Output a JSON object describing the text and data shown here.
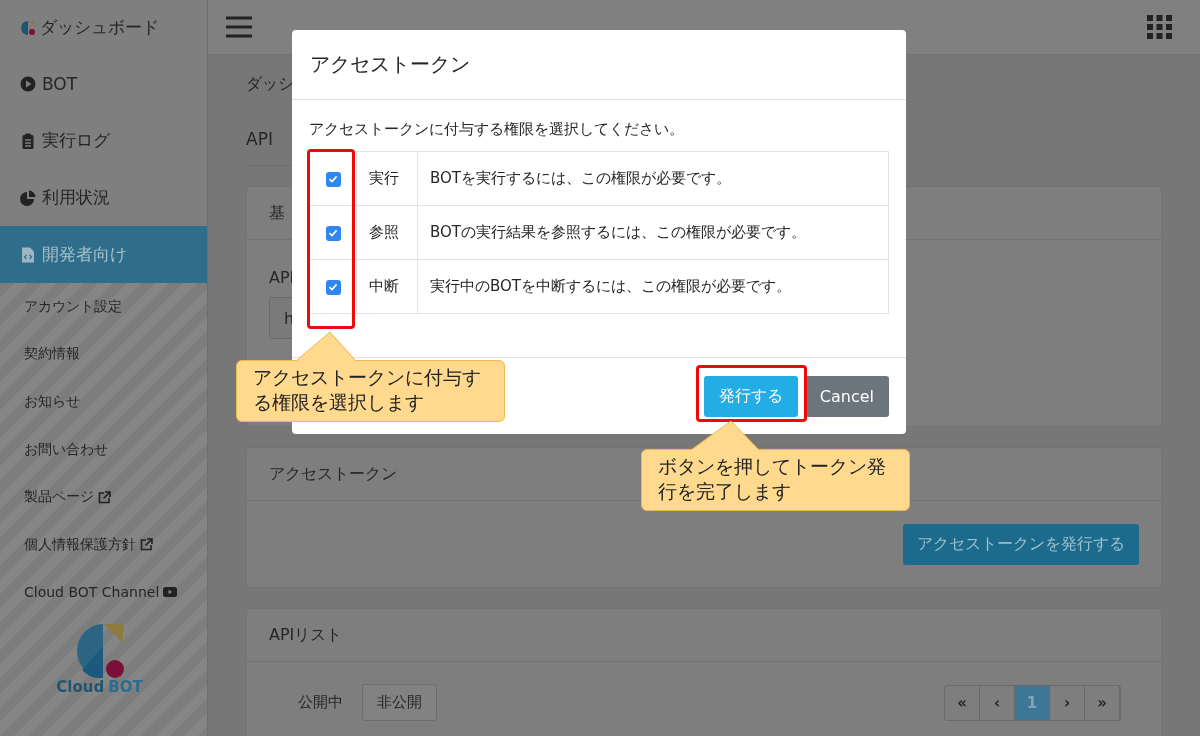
{
  "sidebar": {
    "brand": "ダッシュボード",
    "items": [
      {
        "label": "BOT",
        "selected": false
      },
      {
        "label": "実行ログ",
        "selected": false
      },
      {
        "label": "利用状況",
        "selected": false
      },
      {
        "label": "開発者向け",
        "selected": true
      }
    ],
    "sub_items": [
      {
        "label": "アカウント設定",
        "kind": "plain"
      },
      {
        "label": "契約情報",
        "kind": "plain"
      },
      {
        "label": "お知らせ",
        "kind": "plain"
      },
      {
        "label": "お問い合わせ",
        "kind": "plain"
      },
      {
        "label": "製品ページ",
        "kind": "external"
      },
      {
        "label": "個人情報保護方針",
        "kind": "external"
      },
      {
        "label": "Cloud BOT Channel",
        "kind": "video"
      }
    ],
    "logo": {
      "word_1": "Cloud",
      "word_2": "BOT"
    }
  },
  "breadcrumb": "ダッシ",
  "page_title": "API",
  "basic_card": {
    "title": "基",
    "field_label": "API",
    "field_value": "h"
  },
  "token_card": {
    "title": "アクセストークン",
    "button": "アクセストークンを発行する"
  },
  "api_list_card": {
    "title": "APIリスト",
    "tabs": [
      {
        "label": "公開中",
        "selected": true
      },
      {
        "label": "非公開",
        "selected": false
      }
    ],
    "pagination": [
      {
        "label": "«",
        "selected": false
      },
      {
        "label": "‹",
        "selected": false
      },
      {
        "label": "1",
        "selected": true
      },
      {
        "label": "›",
        "selected": false
      },
      {
        "label": "»",
        "selected": false
      }
    ]
  },
  "modal": {
    "title": "アクセストークン",
    "description": "アクセストークンに付与する権限を選択してください。",
    "permissions": [
      {
        "name": "実行",
        "description": "BOTを実行するには、この権限が必要です。",
        "checked": true
      },
      {
        "name": "参照",
        "description": "BOTの実行結果を参照するには、この権限が必要です。",
        "checked": true
      },
      {
        "name": "中断",
        "description": "実行中のBOTを中断するには、この権限が必要です。",
        "checked": true
      }
    ],
    "buttons": [
      {
        "label": "発行する",
        "kind": "primary"
      },
      {
        "label": "Cancel",
        "kind": "secondary"
      }
    ]
  },
  "annotations": [
    {
      "text": "アクセストークンに付与する権限を選択します"
    },
    {
      "text": "ボタンを押してトークン発行を完了します"
    }
  ]
}
